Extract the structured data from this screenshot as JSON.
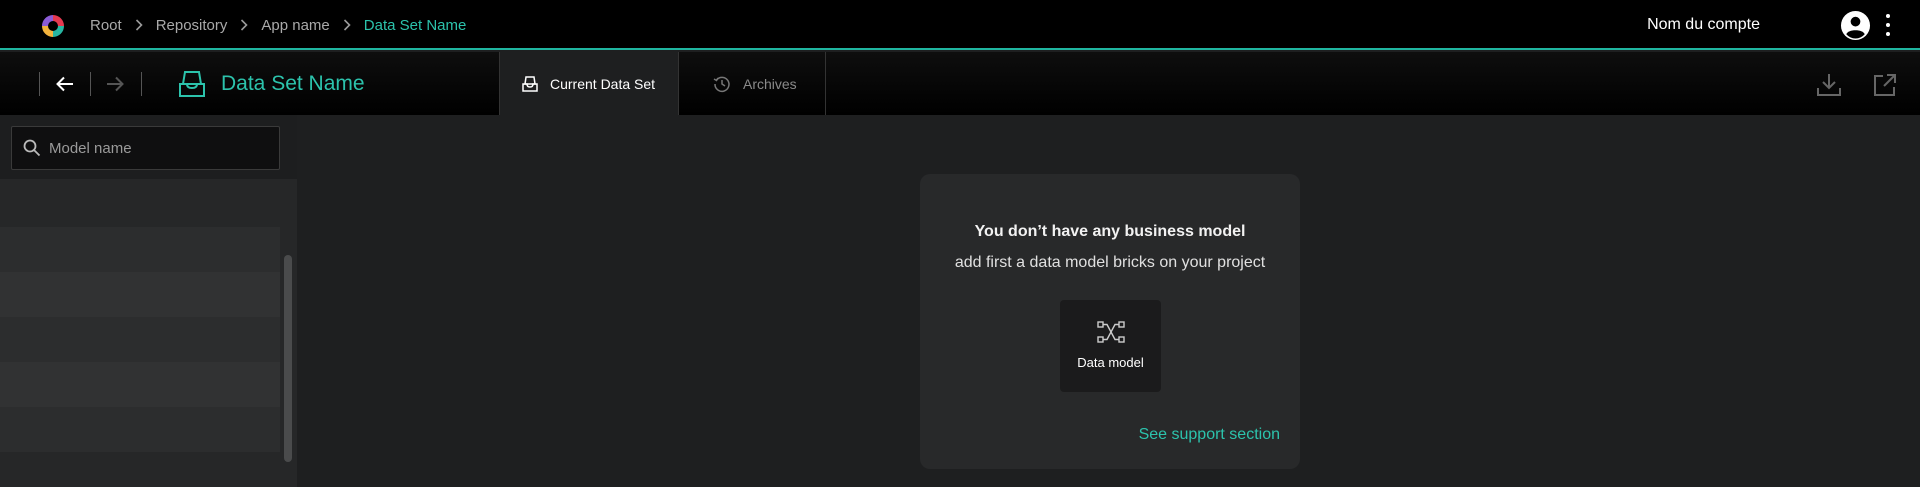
{
  "breadcrumb": [
    {
      "label": "Root"
    },
    {
      "label": "Repository"
    },
    {
      "label": "App name"
    },
    {
      "label": "Data Set Name"
    }
  ],
  "account": {
    "name": "Nom du compte",
    "avatar_icon": "user-circle-icon",
    "menu_icon": "kebab-menu-icon"
  },
  "toolbar": {
    "title": "Data Set Name",
    "back_icon": "arrow-left-icon",
    "forward_icon": "arrow-right-icon",
    "dataset_icon": "dataset-tray-icon",
    "download_icon": "download-icon",
    "open_external_icon": "external-link-icon"
  },
  "tabs": [
    {
      "label": "Current Data Set",
      "icon": "dataset-tray-icon",
      "active": true
    },
    {
      "label": "Archives",
      "icon": "history-icon",
      "active": false
    }
  ],
  "sidebar": {
    "search": {
      "placeholder": "Model name",
      "value": ""
    },
    "rows": 5
  },
  "empty_state": {
    "title": "You don’t have any business model",
    "subtitle": "add first a data model bricks on your project",
    "action": {
      "label": "Data model",
      "icon": "data-model-icon"
    },
    "support_link": "See support section"
  },
  "colors": {
    "accent": "#2cc3ac",
    "background": "#1e1f20",
    "topbar": "#000000"
  }
}
